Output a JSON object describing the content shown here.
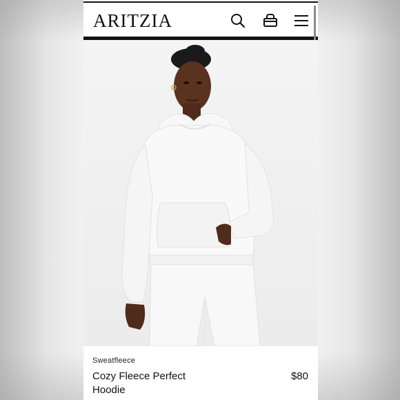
{
  "header": {
    "logo_text": "ARITZIA",
    "icons": [
      "search-icon",
      "shopping-bag-icon",
      "menu-icon"
    ]
  },
  "hero": {
    "image": "model-white-hoodie-photo"
  },
  "product": {
    "collection": "Sweatfleece",
    "name": "Cozy Fleece Perfect Hoodie",
    "price": "$80"
  },
  "colors": {
    "brand": "#111111",
    "background": "#ffffff",
    "garment": "#f7f7f7",
    "skin": "#5a3320"
  }
}
